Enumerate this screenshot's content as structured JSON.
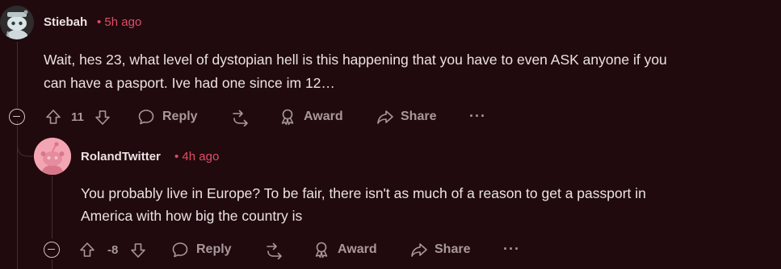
{
  "comments": [
    {
      "username": "Stiebah",
      "time": "• 5h ago",
      "body_lines": [
        "Wait, hes 23, what level of dystopian hell is this happening that you have to even ASK anyone if you",
        "can have a pasport. Ive had one since im 12…"
      ],
      "votes": "11",
      "reply_label": "Reply",
      "award_label": "Award",
      "share_label": "Share",
      "more_label": "···"
    },
    {
      "username": "RolandTwitter",
      "time": "• 4h ago",
      "body_lines": [
        "You probably live in Europe? To be fair, there isn't as much of a reason to get a passport in",
        "America with how big the country is"
      ],
      "votes": "-8",
      "reply_label": "Reply",
      "award_label": "Award",
      "share_label": "Share",
      "more_label": "···"
    }
  ],
  "colors": {
    "background": "#200a0d",
    "timestamp": "#e04d67",
    "action_text": "#a9989b",
    "avatar_reply": "#f4a5b3"
  },
  "icons": {
    "upvote": "arrow-up-icon",
    "downvote": "arrow-down-icon",
    "reply": "speech-bubble-icon",
    "crosspost": "crosspost-icon",
    "award": "award-ribbon-icon",
    "share": "share-arrow-icon",
    "collapse": "collapse-minus-icon",
    "more": "more-options-icon"
  }
}
